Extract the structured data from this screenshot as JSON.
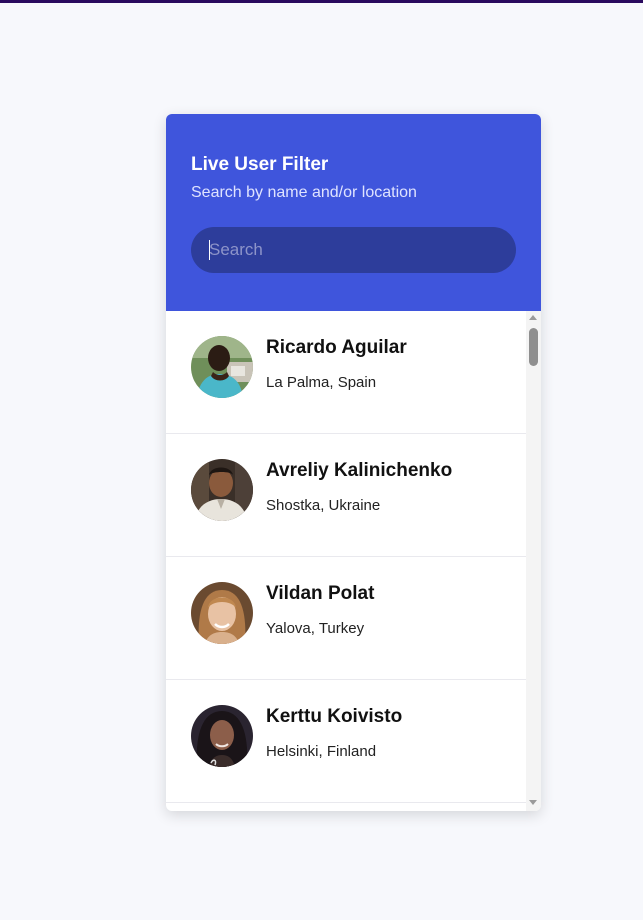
{
  "app": {
    "title": "Live User Filter",
    "subtitle": "Search by name and/or location"
  },
  "search": {
    "placeholder": "Search",
    "value": ""
  },
  "colors": {
    "header_bg": "#3f55dc",
    "search_bg": "#2d3d9b",
    "page_bg": "#f7f8fc",
    "top_strip": "#2a0a5e"
  },
  "users": [
    {
      "name": "Ricardo Aguilar",
      "location": "La Palma, Spain"
    },
    {
      "name": "Avreliy Kalinichenko",
      "location": "Shostka, Ukraine"
    },
    {
      "name": "Vildan Polat",
      "location": "Yalova, Turkey"
    },
    {
      "name": "Kerttu Koivisto",
      "location": "Helsinki, Finland"
    }
  ]
}
